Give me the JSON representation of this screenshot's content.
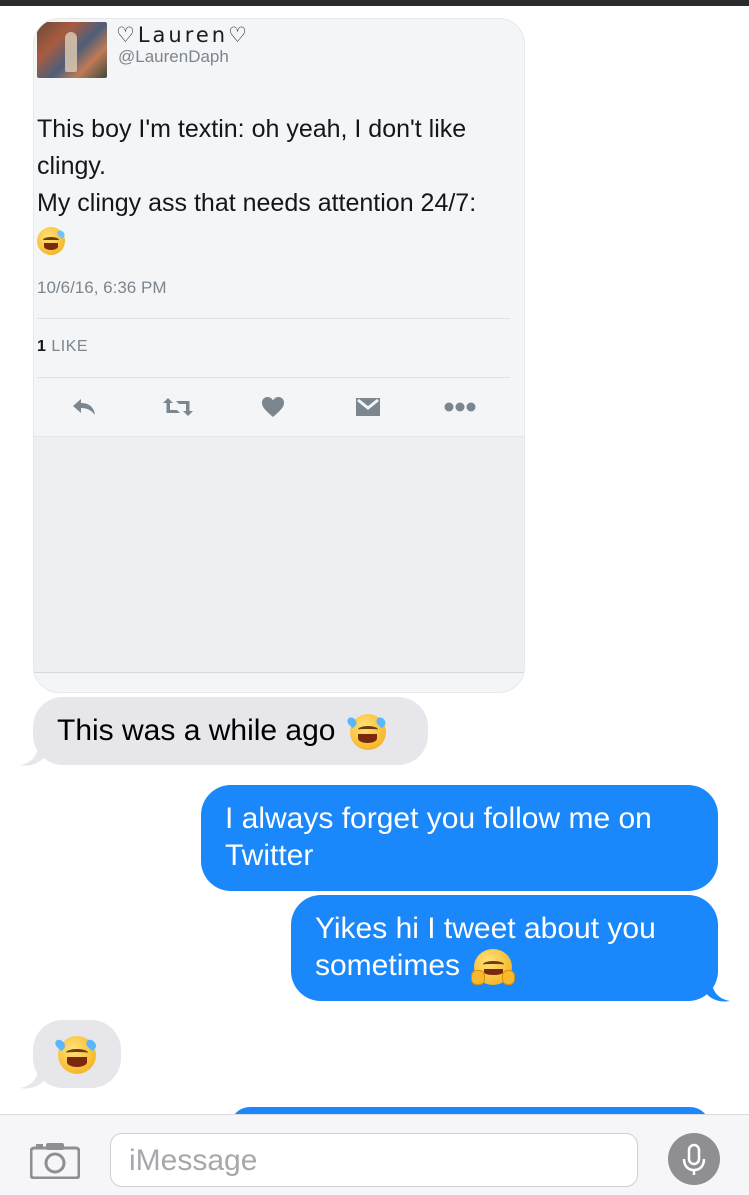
{
  "tweet": {
    "name": "♡Lauren♡",
    "handle": "@LaurenDaph",
    "text_lines": [
      "This boy I'm textin: oh yeah, I don't like",
      "clingy.",
      "My clingy ass that needs attention 24/7:"
    ],
    "timestamp": "10/6/16, 6:36 PM",
    "likes_count": "1",
    "likes_label": "LIKE",
    "actions": [
      "reply-icon",
      "retweet-icon",
      "heart-icon",
      "message-icon",
      "more-icon"
    ]
  },
  "messages": [
    {
      "direction": "incoming",
      "text": "This was a while ago",
      "emoji": "joy"
    },
    {
      "direction": "outgoing",
      "lines": [
        "I always forget you follow me on",
        "Twitter"
      ]
    },
    {
      "direction": "outgoing",
      "lines": [
        "Yikes hi I tweet about you",
        "sometimes"
      ],
      "emoji": "hugging"
    },
    {
      "direction": "incoming",
      "text": "",
      "emoji": "joy"
    }
  ],
  "composer": {
    "placeholder": "iMessage"
  },
  "colors": {
    "outgoing_bubble": "#1a87fb",
    "incoming_bubble": "#e6e6eb",
    "tweet_secondary": "#7c868f"
  }
}
